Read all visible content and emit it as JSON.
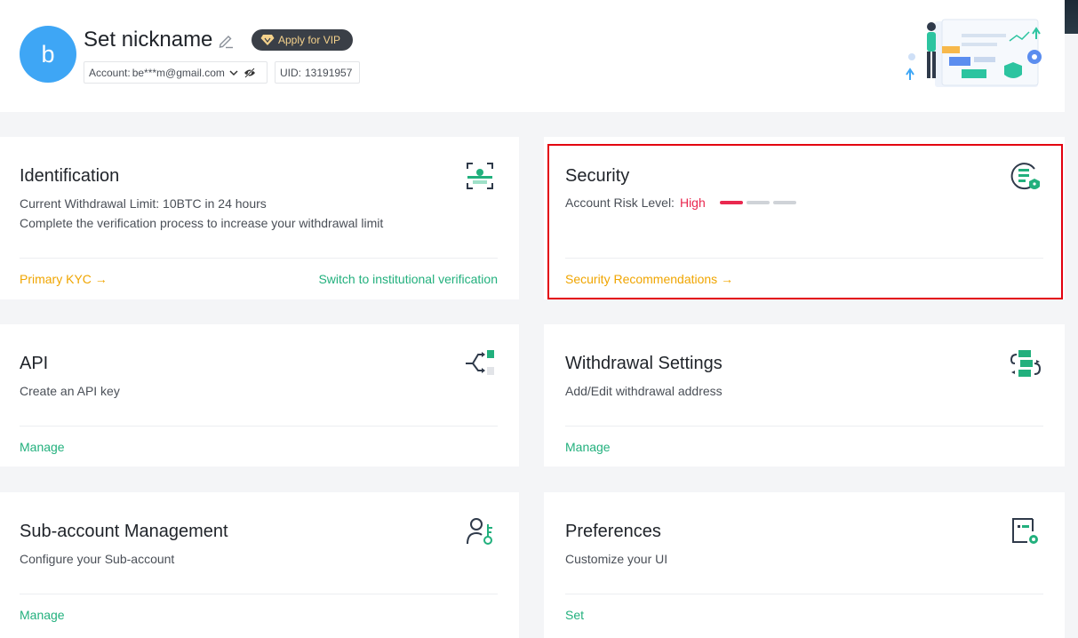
{
  "profile": {
    "avatar_letter": "b",
    "nickname": "Set nickname",
    "vip_label": "Apply for VIP",
    "account_label": "Account:",
    "account_value": "be***m@gmail.com",
    "uid_label": "UID:",
    "uid_value": "13191957"
  },
  "cards": {
    "identification": {
      "title": "Identification",
      "line1": "Current Withdrawal Limit: 10BTC in 24 hours",
      "line2": "Complete the verification process to increase your withdrawal limit",
      "link_left": "Primary KYC →",
      "link_right": "Switch to institutional verification"
    },
    "security": {
      "title": "Security",
      "risk_label": "Account Risk Level:",
      "risk_value": "High",
      "risk_level_filled": 1,
      "risk_level_total": 3,
      "link": "Security Recommendations →"
    },
    "api": {
      "title": "API",
      "desc": "Create an API key",
      "link": "Manage"
    },
    "withdrawal": {
      "title": "Withdrawal Settings",
      "desc": "Add/Edit withdrawal address",
      "link": "Manage"
    },
    "subaccount": {
      "title": "Sub-account Management",
      "desc": "Configure your Sub-account",
      "link": "Manage"
    },
    "preferences": {
      "title": "Preferences",
      "desc": "Customize your UI",
      "link": "Set"
    }
  },
  "colors": {
    "accent_green": "#22b07d",
    "accent_orange": "#f0a500",
    "risk_red": "#e9284f",
    "avatar_blue": "#3ea6f5",
    "highlight_border": "#e3000f"
  },
  "icons": [
    "edit-icon",
    "diamond-icon",
    "chevron-down-icon",
    "eye-off-icon",
    "face-scan-icon",
    "shield-doc-icon",
    "api-icon",
    "withdrawal-icon",
    "user-key-icon",
    "settings-doc-icon"
  ]
}
